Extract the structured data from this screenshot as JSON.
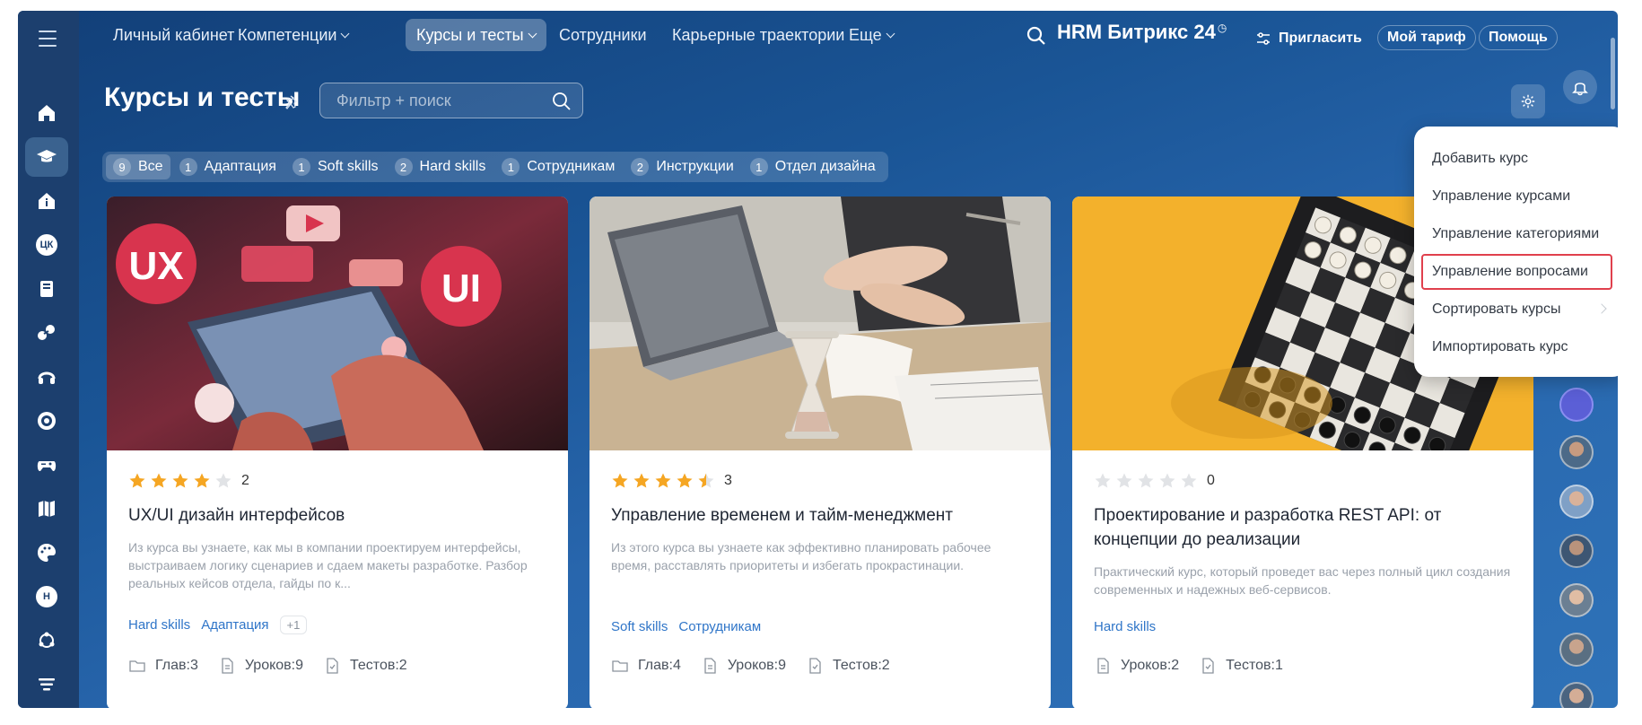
{
  "topnav": {
    "items": [
      {
        "label": "Личный кабинет"
      },
      {
        "label": "Компетенции"
      },
      {
        "label": "Курсы и тесты"
      },
      {
        "label": "Сотрудники"
      },
      {
        "label": "Карьерные траектории"
      },
      {
        "label": "Еще"
      }
    ],
    "brand": "HRM Битрикс 24",
    "invite_label": "Пригласить",
    "tariff_label": "Мой тариф",
    "help_label": "Помощь"
  },
  "sidebar": {
    "items": [
      {
        "icon": "home-icon"
      },
      {
        "icon": "graduation-cap-icon"
      },
      {
        "icon": "info-house-icon"
      },
      {
        "icon": "competencies-icon",
        "text": "ЦК"
      },
      {
        "icon": "book-icon"
      },
      {
        "icon": "share-icon"
      },
      {
        "icon": "headset-icon"
      },
      {
        "icon": "target-icon"
      },
      {
        "icon": "gamepad-icon"
      },
      {
        "icon": "map-icon"
      },
      {
        "icon": "palette-icon"
      },
      {
        "icon": "letter-h-icon",
        "text": "Н"
      },
      {
        "icon": "workflow-icon"
      },
      {
        "icon": "filter-stack-icon"
      }
    ]
  },
  "page": {
    "title": "Курсы и тесты",
    "search_placeholder": "Фильтр + поиск"
  },
  "tags": [
    {
      "count": "9",
      "label": "Все"
    },
    {
      "count": "1",
      "label": "Адаптация"
    },
    {
      "count": "1",
      "label": "Soft skills"
    },
    {
      "count": "2",
      "label": "Hard skills"
    },
    {
      "count": "1",
      "label": "Сотрудникам"
    },
    {
      "count": "2",
      "label": "Инструкции"
    },
    {
      "count": "1",
      "label": "Отдел дизайна"
    }
  ],
  "cards": [
    {
      "rating": 4,
      "rating_count": "2",
      "title": "UX/UI дизайн интерфейсов",
      "description": "Из курса вы узнаете, как мы в компании проектируем интерфейсы, выстраиваем логику сценариев и сдаем макеты разработке. Разбор реальных кейсов отдела, гайды по к...",
      "tags": [
        "Hard skills",
        "Адаптация"
      ],
      "more_tags": "+1",
      "meta": [
        {
          "icon": "folder-icon",
          "label": "Глав:",
          "value": "3"
        },
        {
          "icon": "document-icon",
          "label": "Уроков:",
          "value": "9"
        },
        {
          "icon": "test-icon",
          "label": "Тестов:",
          "value": "2"
        }
      ],
      "image_texts": [
        "UX",
        "UI"
      ]
    },
    {
      "rating": 4.5,
      "rating_count": "3",
      "title": "Управление временем и тайм-менеджмент",
      "description": "Из этого курса вы узнаете как эффективно планировать рабочее время, расставлять приоритеты и избегать прокрастинации.",
      "tags": [
        "Soft skills",
        "Сотрудникам"
      ],
      "meta": [
        {
          "icon": "folder-icon",
          "label": "Глав:",
          "value": "4"
        },
        {
          "icon": "document-icon",
          "label": "Уроков:",
          "value": "9"
        },
        {
          "icon": "test-icon",
          "label": "Тестов:",
          "value": "2"
        }
      ]
    },
    {
      "rating": 0,
      "rating_count": "0",
      "title": "Проектирование и разработка REST API: от концепции до реализации",
      "description": "Практический курс, который проведет вас через полный цикл создания современных и надежных веб-сервисов.",
      "tags": [
        "Hard skills"
      ],
      "meta": [
        {
          "icon": "document-icon",
          "label": "Уроков:",
          "value": "2"
        },
        {
          "icon": "test-icon",
          "label": "Тестов:",
          "value": "1"
        }
      ]
    }
  ],
  "menu": {
    "items": [
      {
        "label": "Добавить курс"
      },
      {
        "label": "Управление курсами"
      },
      {
        "label": "Управление категориями"
      },
      {
        "label": "Управление вопросами",
        "highlighted": true
      },
      {
        "label": "Сортировать курсы",
        "has_submenu": true
      },
      {
        "label": "Импортировать курс"
      }
    ]
  },
  "colors": {
    "accent": "#2f75c8",
    "star": "#f5a623",
    "highlight_border": "#e0404d"
  }
}
